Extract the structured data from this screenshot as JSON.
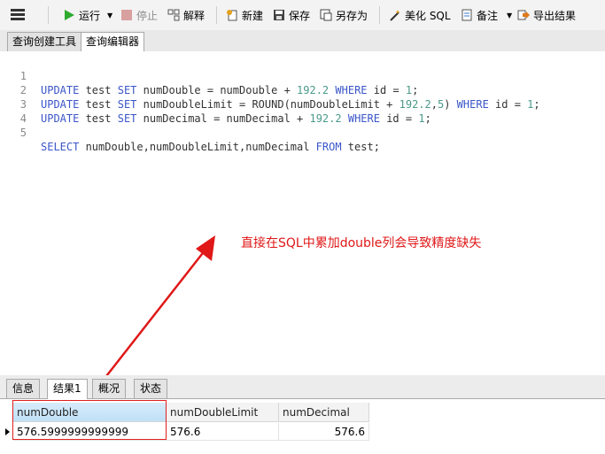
{
  "toolbar": {
    "run": "运行",
    "stop": "停止",
    "explain": "解释",
    "new": "新建",
    "save": "保存",
    "save_as": "另存为",
    "beautify": "美化 SQL",
    "note": "备注",
    "export": "导出结果"
  },
  "tabs_top": [
    "查询创建工具",
    "查询编辑器"
  ],
  "editor": {
    "line_numbers": [
      "1",
      "2",
      "3",
      "4",
      "5"
    ]
  },
  "annotation": "直接在SQL中累加double列会导致精度缺失",
  "bottom_tabs": [
    "信息",
    "结果1",
    "概况",
    "状态"
  ],
  "result": {
    "columns": [
      "numDouble",
      "numDoubleLimit",
      "numDecimal"
    ],
    "rows": [
      [
        "576.5999999999999",
        "576.6",
        "576.6"
      ]
    ]
  },
  "colors": {
    "keyword": "#3b56c9",
    "number": "#4a9a8a",
    "annotation": "#e01818"
  }
}
